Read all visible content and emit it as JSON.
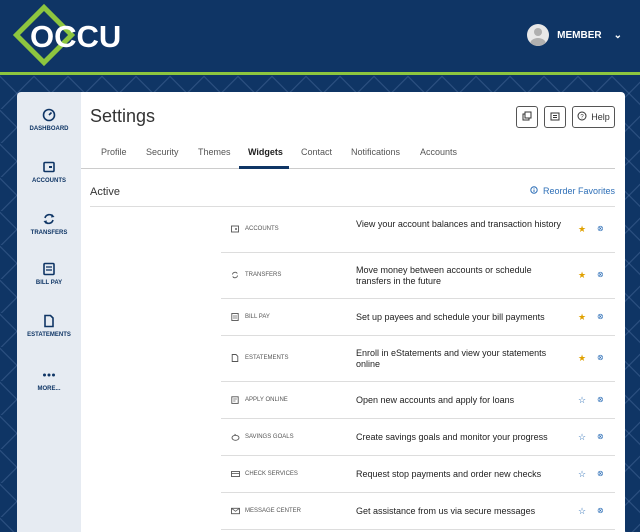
{
  "brand": {
    "logo_text": "OCCU",
    "accent": "#8dc63f",
    "primary": "#0f3565"
  },
  "header": {
    "user_label": "MEMBER"
  },
  "sidebar": {
    "items": [
      {
        "label": "DASHBOARD",
        "icon": "dashboard-gauge-icon"
      },
      {
        "label": "ACCOUNTS",
        "icon": "wallet-icon"
      },
      {
        "label": "TRANSFERS",
        "icon": "transfer-arrows-icon"
      },
      {
        "label": "BILL PAY",
        "icon": "bill-icon"
      },
      {
        "label": "ESTATEMENTS",
        "icon": "document-icon"
      },
      {
        "label": "MORE...",
        "icon": "more-dots-icon"
      }
    ]
  },
  "page": {
    "title": "Settings",
    "help_label": "Help"
  },
  "tabs": [
    {
      "label": "Profile"
    },
    {
      "label": "Security"
    },
    {
      "label": "Themes"
    },
    {
      "label": "Widgets",
      "active": true
    },
    {
      "label": "Contact"
    },
    {
      "label": "Notifications"
    },
    {
      "label": "Accounts"
    }
  ],
  "widgets": {
    "section_title": "Active",
    "reorder_label": "Reorder Favorites",
    "rows": [
      {
        "name": "ACCOUNTS",
        "icon": "wallet-icon",
        "description": "View your account balances and transaction history",
        "favorite": true
      },
      {
        "name": "TRANSFERS",
        "icon": "transfer-arrows-icon",
        "description": "Move money between accounts or schedule transfers in the future",
        "favorite": true
      },
      {
        "name": "BILL PAY",
        "icon": "bill-icon",
        "description": "Set up payees and schedule your bill payments",
        "favorite": true
      },
      {
        "name": "ESTATEMENTS",
        "icon": "document-icon",
        "description": "Enroll in eStatements and view your statements online",
        "favorite": true
      },
      {
        "name": "APPLY ONLINE",
        "icon": "form-icon",
        "description": "Open new accounts and apply for loans",
        "favorite": false
      },
      {
        "name": "SAVINGS GOALS",
        "icon": "piggy-bank-icon",
        "description": "Create savings goals and monitor your progress",
        "favorite": false
      },
      {
        "name": "CHECK SERVICES",
        "icon": "check-icon",
        "description": "Request stop payments and order new checks",
        "favorite": false
      },
      {
        "name": "MESSAGE CENTER",
        "icon": "envelope-icon",
        "description": "Get assistance from us via secure messages",
        "favorite": false
      }
    ]
  },
  "colors": {
    "star_active": "#e0a100",
    "star_inactive": "#2e6fb7",
    "link": "#2e6fb7"
  }
}
